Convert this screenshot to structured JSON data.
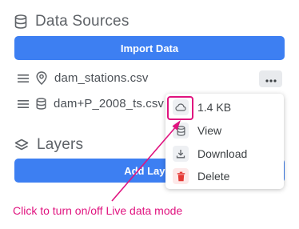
{
  "data_sources": {
    "title": "Data Sources",
    "icon": "database-icon",
    "import_label": "Import Data",
    "items": [
      {
        "name": "dam_stations.csv",
        "type_icon": "map-pin-icon"
      },
      {
        "name": "dam+P_2008_ts.csv",
        "type_icon": "database-icon"
      }
    ]
  },
  "context_menu": {
    "size": "1.4 KB",
    "view": "View",
    "download": "Download",
    "delete": "Delete"
  },
  "layers": {
    "title": "Layers",
    "icon": "layers-icon",
    "add_label": "Add Layer"
  },
  "annotation": {
    "text": "Click to turn on/off Live data mode",
    "color": "#e0137f"
  },
  "colors": {
    "primary": "#3d7ff2",
    "danger": "#e53935",
    "highlight": "#e0137f"
  }
}
